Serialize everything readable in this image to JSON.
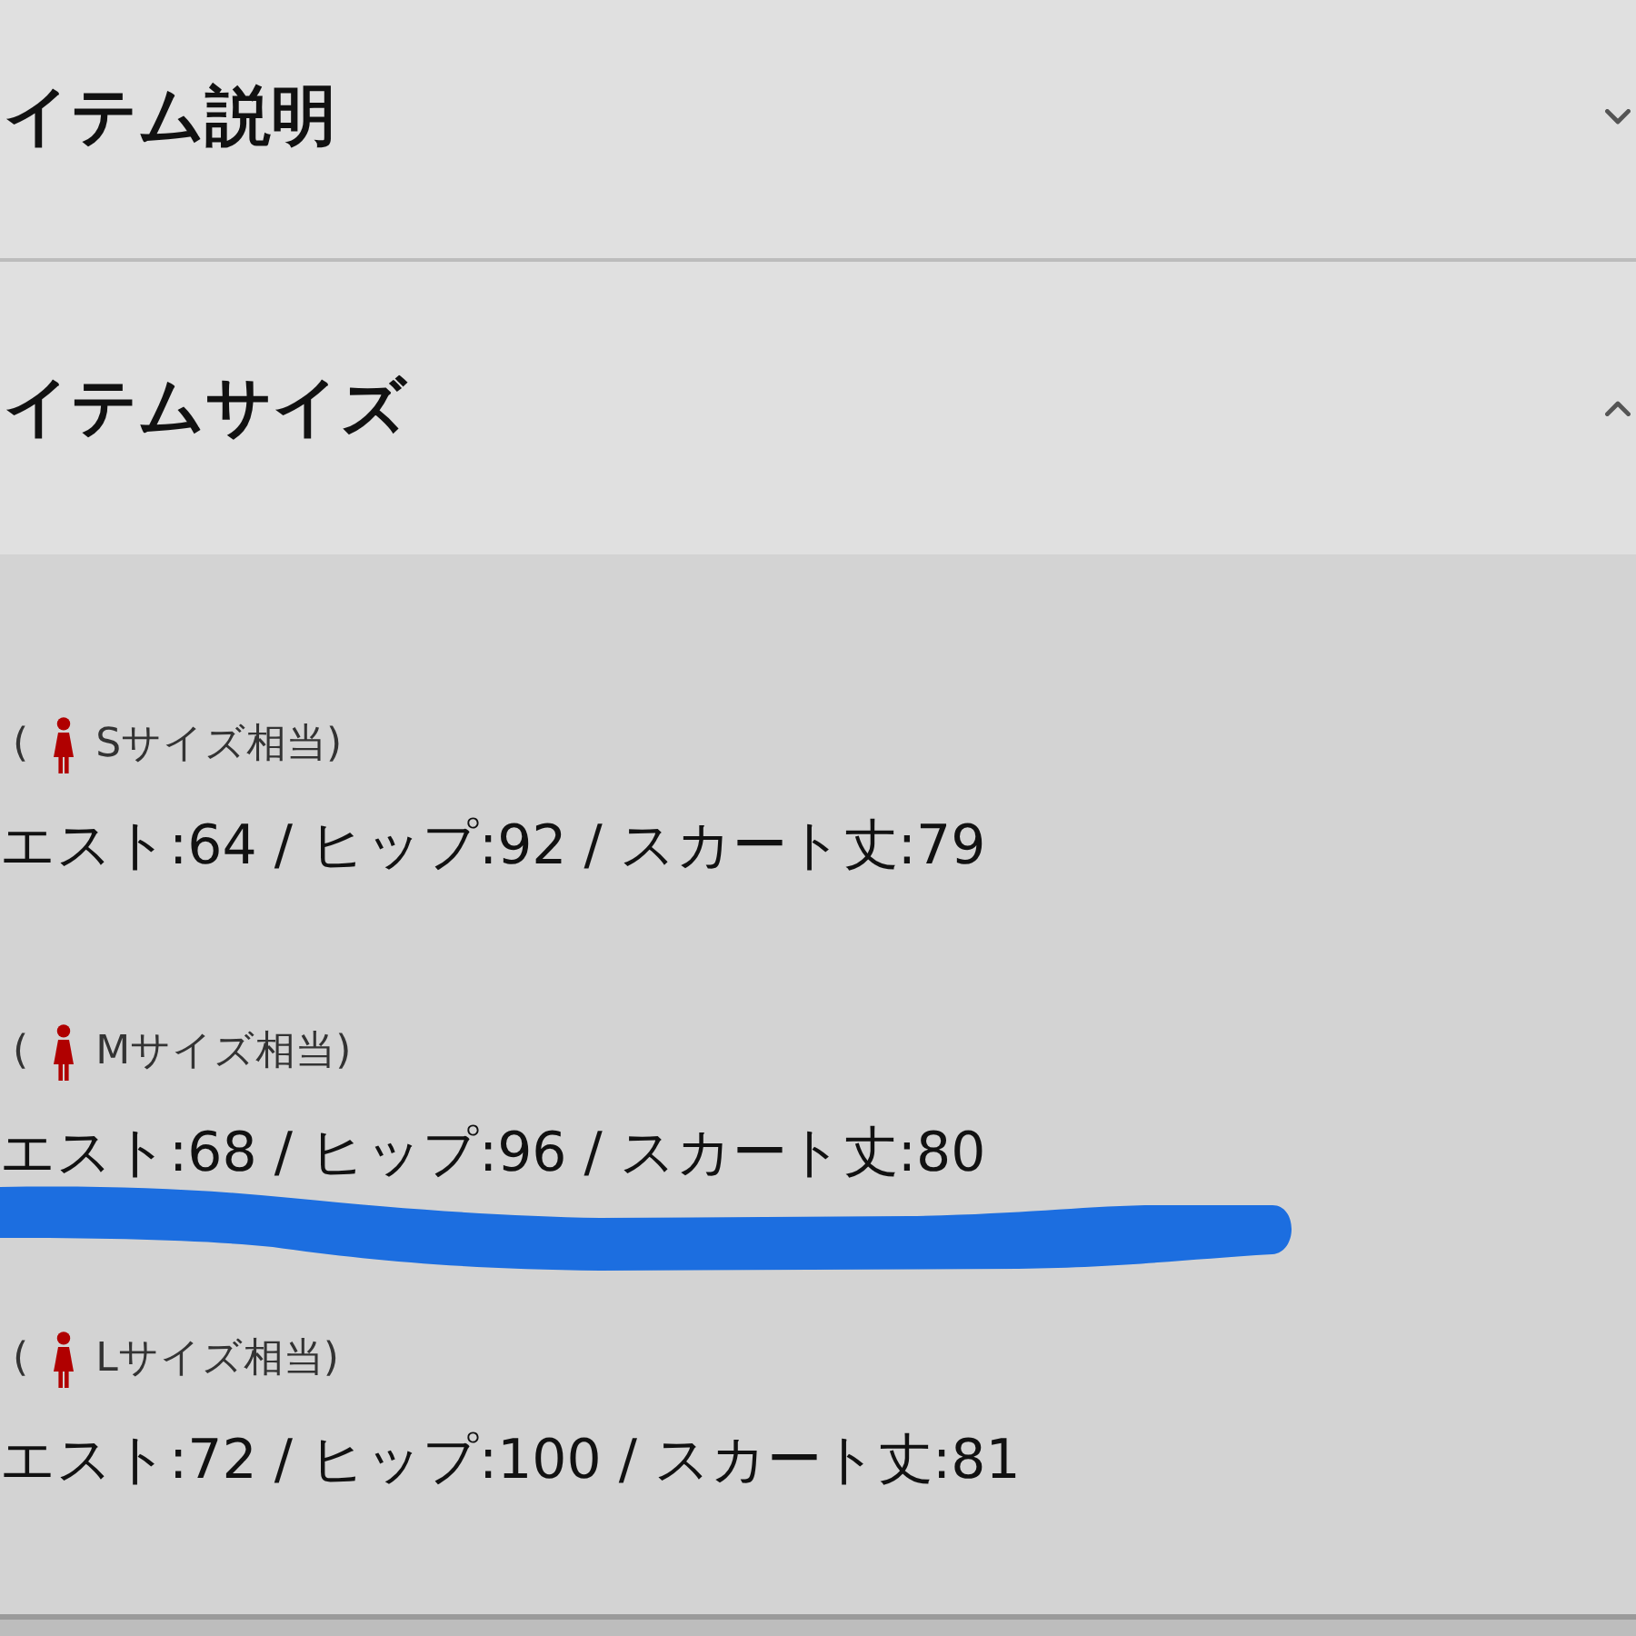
{
  "sections": [
    {
      "title": "イテム説明",
      "expanded": false
    },
    {
      "title": "イテムサイズ",
      "expanded": true,
      "sizes": [
        {
          "prefix": "(",
          "label": "Sサイズ相当)",
          "measurements": "エスト:64 / ヒップ:92 / スカート丈:79",
          "highlighted": false
        },
        {
          "prefix": "(",
          "label": "Mサイズ相当)",
          "measurements": "エスト:68 / ヒップ:96 / スカート丈:80",
          "highlighted": true
        },
        {
          "prefix": "(",
          "label": "Lサイズ相当)",
          "measurements": "エスト:72 / ヒップ:100 / スカート丈:81",
          "highlighted": false
        }
      ]
    }
  ]
}
